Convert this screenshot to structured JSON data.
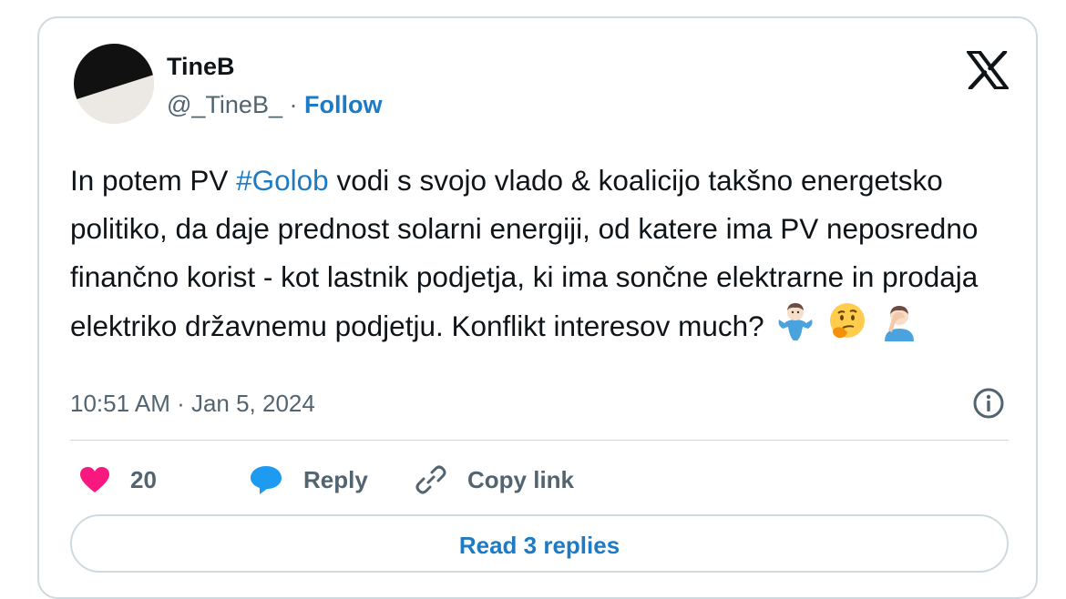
{
  "author": {
    "name": "TineB",
    "handle": "@_TineB_",
    "separator": " · ",
    "follow_label": "Follow"
  },
  "tweet": {
    "text_before": "In potem PV ",
    "hashtag": "#Golob",
    "text_after": " vodi s svojo vlado & koalicijo takšno energetsko politiko, da daje prednost solarni energiji, od katere ima PV neposredno finančno korist - kot lastnik podjetja, ki ima sončne elektrarne in prodaja elektriko državnemu podjetju. Konflikt interesov much?",
    "emojis": [
      "person-shrugging-emoji",
      "thinking-face-emoji",
      "person-facepalming-emoji"
    ],
    "timestamp": "10:51 AM · Jan 5, 2024"
  },
  "actions": {
    "likes_count": "20",
    "reply_label": "Reply",
    "copy_link_label": "Copy link"
  },
  "read_replies_label": "Read 3 replies",
  "colors": {
    "link": "#1d7bc6",
    "heart": "#f91880",
    "reply_icon": "#1d9bf0",
    "muted": "#536471",
    "border": "#cfd9de"
  },
  "icons": [
    "x-logo-icon",
    "info-icon",
    "heart-icon",
    "reply-bubble-icon",
    "link-icon"
  ]
}
